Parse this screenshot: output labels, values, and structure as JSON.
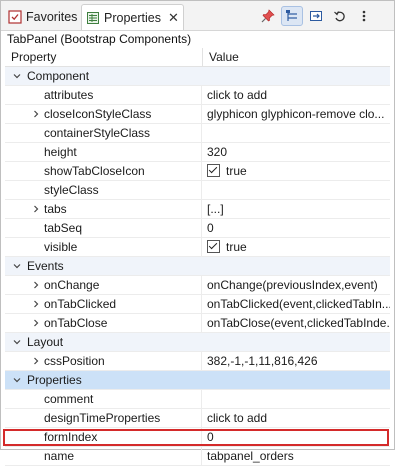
{
  "tabs": {
    "favorites": "Favorites",
    "properties": "Properties",
    "close_glyph": "✕"
  },
  "toolbar": {
    "icons": [
      "pin-icon",
      "categories-icon",
      "link-icon",
      "restore-default-icon",
      "menu-icon"
    ]
  },
  "title": "TabPanel (Bootstrap Components)",
  "header": {
    "property": "Property",
    "value": "Value"
  },
  "rows": [
    {
      "kind": "category",
      "label": "Component",
      "state": "expanded"
    },
    {
      "kind": "prop",
      "label": "attributes",
      "value": "click to add"
    },
    {
      "kind": "prop",
      "label": "closeIconStyleClass",
      "value": "glyphicon glyphicon-remove clo...",
      "expandable": true
    },
    {
      "kind": "prop",
      "label": "containerStyleClass",
      "value": ""
    },
    {
      "kind": "prop",
      "label": "height",
      "value": "320"
    },
    {
      "kind": "prop",
      "label": "showTabCloseIcon",
      "value": "true",
      "checkbox": true
    },
    {
      "kind": "prop",
      "label": "styleClass",
      "value": ""
    },
    {
      "kind": "prop",
      "label": "tabs",
      "value": "[...]",
      "expandable": true
    },
    {
      "kind": "prop",
      "label": "tabSeq",
      "value": "0"
    },
    {
      "kind": "prop",
      "label": "visible",
      "value": "true",
      "checkbox": true
    },
    {
      "kind": "category",
      "label": "Events",
      "state": "expanded"
    },
    {
      "kind": "prop",
      "label": "onChange",
      "value": "onChange(previousIndex,event)",
      "expandable": true
    },
    {
      "kind": "prop",
      "label": "onTabClicked",
      "value": "onTabClicked(event,clickedTabIn...",
      "expandable": true
    },
    {
      "kind": "prop",
      "label": "onTabClose",
      "value": "onTabClose(event,clickedTabInde...",
      "expandable": true
    },
    {
      "kind": "category",
      "label": "Layout",
      "state": "expanded"
    },
    {
      "kind": "prop",
      "label": "cssPosition",
      "value": "382,-1,-1,11,816,426",
      "expandable": true
    },
    {
      "kind": "category",
      "label": "Properties",
      "state": "expanded",
      "selected": true
    },
    {
      "kind": "prop",
      "label": "comment",
      "value": ""
    },
    {
      "kind": "prop",
      "label": "designTimeProperties",
      "value": "click to add"
    },
    {
      "kind": "prop",
      "label": "formIndex",
      "value": "0"
    },
    {
      "kind": "prop",
      "label": "name",
      "value": "tabpanel_orders",
      "highlighted": true
    }
  ]
}
